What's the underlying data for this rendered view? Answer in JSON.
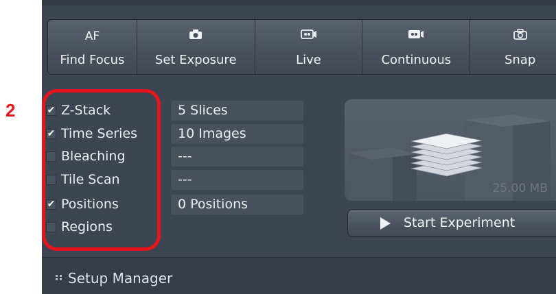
{
  "annotation": {
    "number": "2"
  },
  "toolbar": {
    "af": {
      "top_label": "AF",
      "label": "Find Focus"
    },
    "set_exposure": {
      "label": "Set Exposure"
    },
    "live": {
      "label": "Live"
    },
    "continuous": {
      "label": "Continuous"
    },
    "snap": {
      "label": "Snap"
    }
  },
  "experiments": [
    {
      "label": "Z-Stack",
      "checked": true,
      "value": "5 Slices"
    },
    {
      "label": "Time Series",
      "checked": true,
      "value": "10 Images"
    },
    {
      "label": "Bleaching",
      "checked": false,
      "value": "---"
    },
    {
      "label": "Tile Scan",
      "checked": false,
      "value": "---"
    },
    {
      "label": "Positions",
      "checked": true,
      "value": "0 Positions"
    },
    {
      "label": "Regions",
      "checked": false,
      "value": ""
    }
  ],
  "preview": {
    "size": "25.00 MB"
  },
  "start_button": {
    "label": "Start Experiment"
  },
  "setup_manager": {
    "label": "Setup Manager"
  },
  "colors": {
    "panel": "#3d4552",
    "highlight": "#e8141c",
    "text": "#eceef1"
  }
}
